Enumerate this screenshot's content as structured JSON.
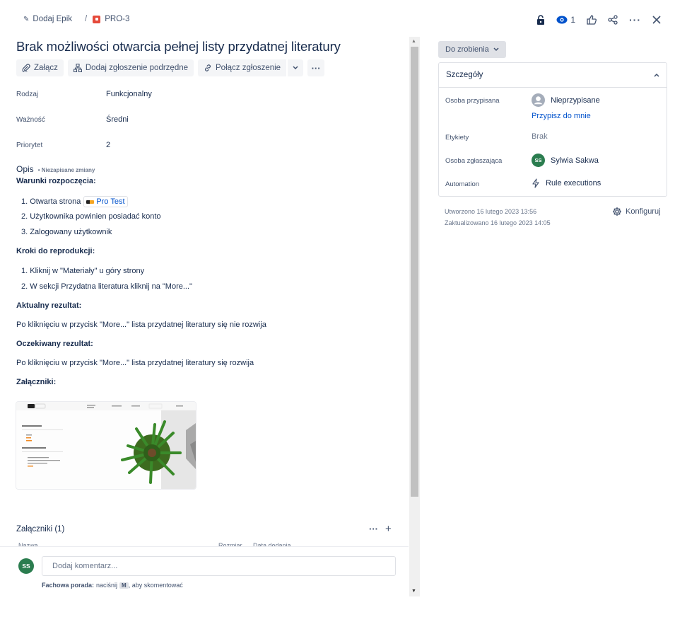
{
  "breadcrumb": {
    "epic_label": "Dodaj Epik",
    "separator": "/",
    "issue_key": "PRO-3"
  },
  "header": {
    "watch_count": "1"
  },
  "issue": {
    "title": "Brak możliwości otwarcia pełnej listy przydatnej literatury",
    "toolbar": {
      "attach": "Załącz",
      "add_child": "Dodaj zgłoszenie podrzędne",
      "link": "Połącz zgłoszenie"
    },
    "fields": [
      {
        "label": "Rodzaj",
        "value": "Funkcjonalny"
      },
      {
        "label": "Ważność",
        "value": "Średni"
      },
      {
        "label": "Priorytet",
        "value": "2"
      }
    ],
    "description": {
      "title": "Opis",
      "unsaved": "• Niezapisane zmiany",
      "h_preconditions": "Warunki rozpoczęcia:",
      "pre_1_prefix": "1. Otwarta strona",
      "pre_1_link": "Pro Test",
      "pre_2": "2. Użytkownika powinien posiadać konto",
      "pre_3": "3. Zalogowany użytkownik",
      "h_steps": "Kroki do reprodukcji:",
      "step_1": "1. Kliknij w \"Materiały\" u góry strony",
      "step_2": "2. W sekcji Przydatna literatura kliknij na \"More...\"",
      "h_actual": "Aktualny rezultat:",
      "actual": "Po kliknięciu w przycisk \"More...\" lista przydatnej literatury się nie rozwija",
      "h_expected": "Oczekiwany rezultat:",
      "expected": "Po kliknięciu w przycisk \"More...\" lista przydatnej literatury się rozwija",
      "h_attachments": "Załączniki:"
    },
    "thumbnail": {
      "logo": "Pro",
      "nav_1": "Materiały",
      "section_1": "Przydatne szkolenia",
      "section_2": "Przydatna literatura"
    },
    "attachments": {
      "title": "Załączniki (1)",
      "col_name": "Nazwa",
      "col_size": "Rozmiar",
      "col_date": "Data dodania"
    }
  },
  "comment": {
    "avatar": "SS",
    "placeholder": "Dodaj komentarz...",
    "tip_bold": "Fachowa porada:",
    "tip_pre": "naciśnij",
    "tip_key": "M",
    "tip_post": ", aby skomentować"
  },
  "sidebar": {
    "status": "Do zrobienia",
    "details_title": "Szczegóły",
    "rows": {
      "assignee_label": "Osoba przypisana",
      "assignee_value": "Nieprzypisane",
      "assign_me": "Przypisz do mnie",
      "labels_label": "Etykiety",
      "labels_value": "Brak",
      "reporter_label": "Osoba zgłaszająca",
      "reporter_avatar": "SS",
      "reporter_value": "Sylwia Sakwa",
      "automation_label": "Automation",
      "automation_value": "Rule executions"
    },
    "created": "Utworzono 16 lutego 2023 13:56",
    "updated": "Zaktualizowano 16 lutego 2023 14:05",
    "configure": "Konfiguruj"
  },
  "colors": {
    "link": "#0052cc",
    "avatar": "#2b7d4f",
    "issue_type": "#e5493a"
  }
}
